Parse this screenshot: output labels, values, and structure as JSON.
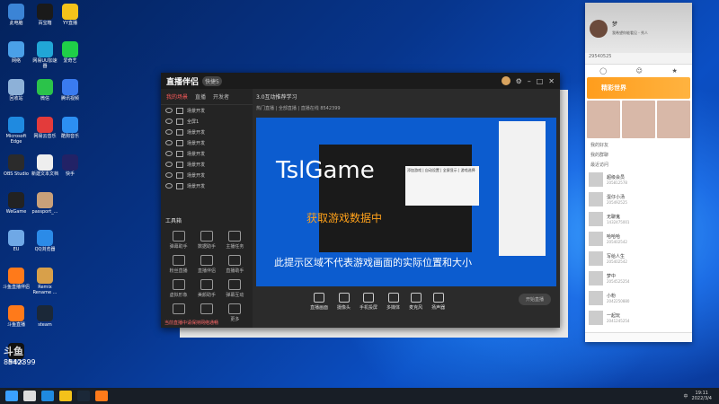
{
  "desktop_icons": [
    {
      "label": "此电脑",
      "color": "#3b84d6"
    },
    {
      "label": "网络",
      "color": "#4aa0e8"
    },
    {
      "label": "回收站",
      "color": "#8db1d8"
    },
    {
      "label": "Microsoft Edge",
      "color": "#1f8ae0"
    },
    {
      "label": "OBS Studio",
      "color": "#2b2b2b"
    },
    {
      "label": "WeGame",
      "color": "#222222"
    },
    {
      "label": "EU",
      "color": "#6fa8e6"
    },
    {
      "label": "斗鱼直播伴侣",
      "color": "#ff7a1a"
    },
    {
      "label": "斗鱼直播",
      "color": "#ff7a1a"
    },
    {
      "label": "腾讯QQ",
      "color": "#111111"
    }
  ],
  "desktop_icons_col2": [
    {
      "label": "百宝箱",
      "color": "#1a1a1a"
    },
    {
      "label": "网易UU加速器",
      "color": "#21a6d6"
    },
    {
      "label": "微信",
      "color": "#2bc34a"
    },
    {
      "label": "网易云音乐",
      "color": "#e33b3b"
    },
    {
      "label": "新建文本文档",
      "color": "#eeeeee"
    },
    {
      "label": "passport_...",
      "color": "#c8a07a"
    },
    {
      "label": "QQ浏览器",
      "color": "#2b8be8"
    },
    {
      "label": "Remix Rename ...",
      "color": "#d8a04a"
    },
    {
      "label": "steam",
      "color": "#1b2838"
    }
  ],
  "desktop_icons_col3": [
    {
      "label": "YY直播",
      "color": "#f4c21a"
    },
    {
      "label": "爱奇艺",
      "color": "#1fcf48"
    },
    {
      "label": "腾讯视频",
      "color": "#3a7bf0"
    },
    {
      "label": "酷狗音乐",
      "color": "#2c8ff2"
    },
    {
      "label": "快手",
      "color": "#222266"
    }
  ],
  "stream_app": {
    "title": "直播伴侣",
    "version_badge": "快捷5",
    "tabs": [
      "我的场景",
      "直播",
      "开发者"
    ],
    "scenes": [
      "场景开发",
      "全屏1",
      "场景开发",
      "场景开发",
      "场景开发",
      "场景开发",
      "场景开发",
      "场景开发"
    ],
    "tools_title": "工具箱",
    "tools": [
      "弹幕助手",
      "数据助手",
      "主播任务",
      "粉丝直播",
      "直播伴侣",
      "直播助手",
      "虚拟形象",
      "美颜助手",
      "弹幕互动",
      "",
      "",
      "更多"
    ],
    "room_title": "3.0互动推荐学习",
    "room_sub": "热门直播 | 全部直播 | 直播在线 8542399",
    "big_text": "TslGame",
    "orange_text": "获取游戏数据中",
    "warn_text": "此提示区域不代表游戏画面的实际位置和大小",
    "context_menu": "添加游戏 | 自动设置 | 全屏显示 | 游戏选择",
    "bottom_items": [
      "直播画面",
      "摄像头",
      "手机投屏",
      "多媒体",
      "麦克风",
      "扬声器"
    ],
    "live_btn": "开始直播",
    "status": "当前直播中请保持网络通畅"
  },
  "qq": {
    "name": "梦",
    "sign": "我希望你能看见 - 秀人",
    "search": "29540525",
    "banner": "精彩世界",
    "sec1": "我的好友",
    "sec2": "我的群聊",
    "sec3": "最近访问",
    "contacts": [
      {
        "name": "超级会员",
        "status": "205812578"
      },
      {
        "name": "蛋仔小汤",
        "status": "205492525"
      },
      {
        "name": "无聊鬼",
        "status": "1432475001"
      },
      {
        "name": "哈哈哈",
        "status": "205402542"
      },
      {
        "name": "写给人生",
        "status": "205402542"
      },
      {
        "name": "梦中",
        "status": "2054525254"
      },
      {
        "name": "小粉",
        "status": "2042250880"
      },
      {
        "name": "一起玩",
        "status": "2041245254"
      }
    ]
  },
  "watermark": {
    "logo": "斗鱼",
    "id": "8542399"
  },
  "taskbar": {
    "time": "19:11",
    "date": "2022/3/4",
    "tray_text": "中"
  }
}
